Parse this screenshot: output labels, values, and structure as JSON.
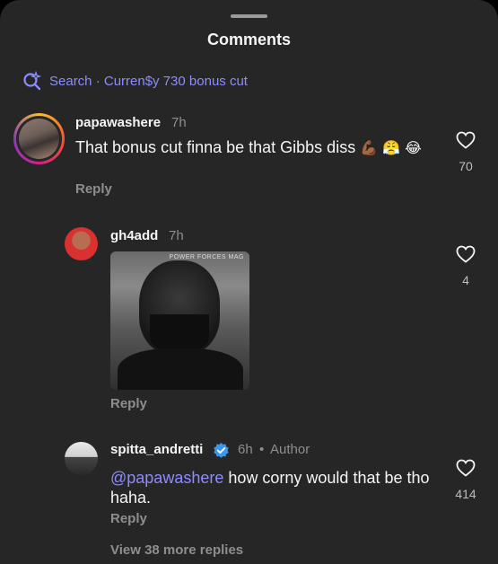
{
  "header": {
    "title": "Comments"
  },
  "search": {
    "label": "Search · Curren$y 730 bonus cut"
  },
  "comments": [
    {
      "username": "papawashere",
      "time": "7h",
      "text": "That bonus cut finna be that Gibbs diss",
      "emojis": [
        "💪🏾",
        "😤",
        "😂"
      ],
      "reply_label": "Reply",
      "like_count": "70"
    },
    {
      "username": "gh4add",
      "time": "7h",
      "image_watermark": "POWER FORCES MAG",
      "reply_label": "Reply",
      "like_count": "4"
    },
    {
      "username": "spitta_andretti",
      "time": "6h",
      "separator": "•",
      "author_label": "Author",
      "mention": "@papawashere",
      "text": "how corny would that be tho haha.",
      "reply_label": "Reply",
      "like_count": "414"
    }
  ],
  "view_more": "View 38 more replies",
  "colors": {
    "background": "#262626",
    "link": "#8c8cff",
    "secondary": "#8e8e8e",
    "verified": "#3897f0"
  },
  "icons": [
    "search-sparkle-icon",
    "heart-icon",
    "verified-badge-icon"
  ]
}
